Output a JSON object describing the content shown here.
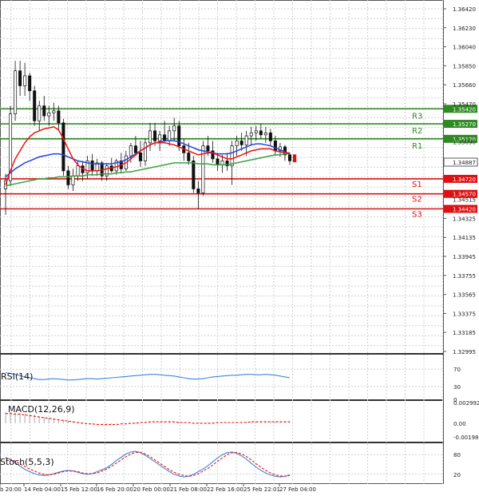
{
  "chart_data": [
    {
      "type": "candlestick",
      "price_axis": [
        "1.36420",
        "1.36230",
        "1.36040",
        "1.35850",
        "1.35660",
        "1.35470",
        "1.35090",
        "1.34325",
        "1.34135",
        "1.33945",
        "1.33755",
        "1.33565",
        "1.33375",
        "1.33185",
        "1.32995"
      ],
      "ylim": [
        1.32995,
        1.3642
      ],
      "x_labels": [
        "b 20:00",
        "14 Feb 04:00",
        "15 Feb 12:00",
        "16 Feb 20:00",
        "20 Feb 00:00",
        "21 Feb 08:00",
        "22 Feb 16:00",
        "25 Feb 22:01",
        "27 Feb 04:00"
      ],
      "current_price": "1.34887",
      "resistance": [
        {
          "name": "R1",
          "value": 1.3512,
          "tag": "1.35120"
        },
        {
          "name": "R2",
          "value": 1.3527,
          "tag": "1.35270"
        },
        {
          "name": "R3",
          "value": 1.3542,
          "tag": "1.35420"
        }
      ],
      "support": [
        {
          "name": "S1",
          "value": 1.3472,
          "tag": "1.34720"
        },
        {
          "name": "S2",
          "value": 1.3457,
          "tag": "1.34570"
        },
        {
          "name": "S3",
          "value": 1.3442,
          "tag": "1.34420"
        }
      ],
      "extra_tag": "1.34515",
      "candles": [
        [
          1.3462,
          1.3477,
          1.3436,
          1.347
        ],
        [
          1.347,
          1.3545,
          1.3465,
          1.3537
        ],
        [
          1.3537,
          1.359,
          1.353,
          1.358
        ],
        [
          1.358,
          1.359,
          1.3555,
          1.3565
        ],
        [
          1.3565,
          1.3588,
          1.3555,
          1.3575
        ],
        [
          1.3575,
          1.3578,
          1.355,
          1.356
        ],
        [
          1.356,
          1.3565,
          1.3525,
          1.353
        ],
        [
          1.353,
          1.355,
          1.352,
          1.3545
        ],
        [
          1.3545,
          1.3555,
          1.353,
          1.3535
        ],
        [
          1.3535,
          1.3545,
          1.3525,
          1.3538
        ],
        [
          1.3538,
          1.3548,
          1.353,
          1.354
        ],
        [
          1.354,
          1.3545,
          1.352,
          1.3528
        ],
        [
          1.3528,
          1.3532,
          1.3475,
          1.348
        ],
        [
          1.348,
          1.3485,
          1.3462,
          1.3466
        ],
        [
          1.3466,
          1.3482,
          1.346,
          1.3475
        ],
        [
          1.3475,
          1.349,
          1.347,
          1.3485
        ],
        [
          1.3485,
          1.349,
          1.347,
          1.3478
        ],
        [
          1.3478,
          1.3495,
          1.3472,
          1.349
        ],
        [
          1.349,
          1.3497,
          1.3475,
          1.348
        ],
        [
          1.348,
          1.3492,
          1.3475,
          1.3488
        ],
        [
          1.3488,
          1.349,
          1.347,
          1.3475
        ],
        [
          1.3475,
          1.3488,
          1.347,
          1.3485
        ],
        [
          1.3485,
          1.3493,
          1.3478,
          1.348
        ],
        [
          1.348,
          1.3492,
          1.3476,
          1.349
        ],
        [
          1.349,
          1.3498,
          1.3478,
          1.3482
        ],
        [
          1.3482,
          1.35,
          1.348,
          1.3495
        ],
        [
          1.3495,
          1.3508,
          1.3488,
          1.3505
        ],
        [
          1.3505,
          1.3515,
          1.3495,
          1.3498
        ],
        [
          1.3498,
          1.351,
          1.3484,
          1.349
        ],
        [
          1.349,
          1.3512,
          1.3485,
          1.3508
        ],
        [
          1.3508,
          1.3528,
          1.35,
          1.352
        ],
        [
          1.352,
          1.3528,
          1.3505,
          1.351
        ],
        [
          1.351,
          1.352,
          1.35,
          1.3516
        ],
        [
          1.3516,
          1.353,
          1.3508,
          1.351
        ],
        [
          1.351,
          1.3525,
          1.3505,
          1.352
        ],
        [
          1.352,
          1.3533,
          1.351,
          1.3525
        ],
        [
          1.3525,
          1.353,
          1.35,
          1.3505
        ],
        [
          1.3505,
          1.3512,
          1.349,
          1.3498
        ],
        [
          1.3498,
          1.3508,
          1.3486,
          1.349
        ],
        [
          1.349,
          1.3495,
          1.3458,
          1.3462
        ],
        [
          1.3462,
          1.347,
          1.3442,
          1.3458
        ],
        [
          1.3458,
          1.351,
          1.3455,
          1.3505
        ],
        [
          1.3505,
          1.3515,
          1.3495,
          1.35
        ],
        [
          1.35,
          1.351,
          1.3488,
          1.3492
        ],
        [
          1.3492,
          1.3498,
          1.348,
          1.3486
        ],
        [
          1.3486,
          1.3496,
          1.3478,
          1.349
        ],
        [
          1.349,
          1.3498,
          1.348,
          1.3485
        ],
        [
          1.3485,
          1.351,
          1.3466,
          1.3505
        ],
        [
          1.3505,
          1.3515,
          1.3495,
          1.351
        ],
        [
          1.351,
          1.3518,
          1.35,
          1.3506
        ],
        [
          1.3506,
          1.352,
          1.3495,
          1.3515
        ],
        [
          1.3515,
          1.3524,
          1.3505,
          1.3518
        ],
        [
          1.3518,
          1.3525,
          1.351,
          1.352
        ],
        [
          1.352,
          1.3527,
          1.3512,
          1.3516
        ],
        [
          1.3516,
          1.3524,
          1.3508,
          1.3518
        ],
        [
          1.3518,
          1.3522,
          1.3505,
          1.351
        ],
        [
          1.351,
          1.3515,
          1.3495,
          1.35
        ],
        [
          1.35,
          1.3508,
          1.3494,
          1.3504
        ],
        [
          1.3504,
          1.3506,
          1.349,
          1.3496
        ],
        [
          1.3496,
          1.3498,
          1.3486,
          1.349
        ]
      ],
      "ma_red": [
        1.3466,
        1.348,
        1.3492,
        1.35,
        1.3508,
        1.3514,
        1.3518,
        1.352,
        1.3522,
        1.3523,
        1.3524,
        1.3521,
        1.3512,
        1.3502,
        1.3492,
        1.3486,
        1.3482,
        1.348,
        1.348,
        1.348,
        1.3481,
        1.3482,
        1.3483,
        1.3484,
        1.3486,
        1.3488,
        1.3492,
        1.3496,
        1.35,
        1.3503,
        1.3506,
        1.3508,
        1.3508,
        1.3508,
        1.3507,
        1.3506,
        1.3504,
        1.3502,
        1.35,
        1.3498,
        1.3496,
        1.3497,
        1.3498,
        1.3498,
        1.3496,
        1.3494,
        1.3492,
        1.3492,
        1.3494,
        1.3496,
        1.3498,
        1.35,
        1.3501,
        1.3502,
        1.3502,
        1.3502,
        1.35,
        1.3499,
        1.3498,
        1.3498
      ],
      "ma_blue": [
        1.3474,
        1.3478,
        1.3482,
        1.3485,
        1.3488,
        1.349,
        1.3492,
        1.3494,
        1.3495,
        1.3496,
        1.3497,
        1.3497,
        1.3496,
        1.3494,
        1.3492,
        1.349,
        1.3489,
        1.3488,
        1.3487,
        1.3487,
        1.3487,
        1.3487,
        1.3487,
        1.3488,
        1.3489,
        1.3491,
        1.3494,
        1.3497,
        1.35,
        1.3503,
        1.3506,
        1.3508,
        1.3509,
        1.351,
        1.351,
        1.351,
        1.3509,
        1.3507,
        1.3505,
        1.3503,
        1.3501,
        1.35,
        1.3499,
        1.3498,
        1.3497,
        1.3497,
        1.3497,
        1.3498,
        1.35,
        1.3502,
        1.3504,
        1.3506,
        1.3507,
        1.3507,
        1.3506,
        1.3505,
        1.3503,
        1.3501,
        1.3499,
        1.3497
      ],
      "ma_green": [
        1.3465,
        1.3466,
        1.3467,
        1.3468,
        1.3469,
        1.347,
        1.3471,
        1.3472,
        1.3472,
        1.3473,
        1.3473,
        1.3474,
        1.3474,
        1.3474,
        1.3475,
        1.3475,
        1.3475,
        1.3476,
        1.3476,
        1.3476,
        1.3477,
        1.3477,
        1.3477,
        1.3478,
        1.3478,
        1.3479,
        1.3479,
        1.348,
        1.3481,
        1.3482,
        1.3483,
        1.3484,
        1.3485,
        1.3486,
        1.3487,
        1.3488,
        1.3488,
        1.3488,
        1.3488,
        1.3488,
        1.3487,
        1.3487,
        1.3487,
        1.3486,
        1.3486,
        1.3486,
        1.3486,
        1.3487,
        1.3488,
        1.3489,
        1.349,
        1.3491,
        1.3492,
        1.3493,
        1.3494,
        1.3495,
        1.3496,
        1.3496,
        1.3497,
        1.3497
      ]
    },
    {
      "type": "line",
      "title": "RSI(14)",
      "ticks": [
        "70",
        "30",
        "0"
      ],
      "ylim": [
        0,
        100
      ],
      "values": [
        62,
        60,
        58,
        55,
        52,
        50,
        48,
        46,
        46,
        47,
        48,
        47,
        46,
        45,
        45,
        46,
        47,
        48,
        48,
        47,
        48,
        49,
        50,
        51,
        52,
        53,
        54,
        55,
        56,
        57,
        58,
        58,
        57,
        56,
        55,
        54,
        52,
        50,
        48,
        47,
        47,
        48,
        50,
        52,
        53,
        54,
        55,
        56,
        56,
        57,
        58,
        58,
        57,
        57,
        58,
        57,
        56,
        54,
        52,
        50
      ]
    },
    {
      "type": "line",
      "title": "MACD(12,26,9)",
      "ticks": [
        "0.002992",
        "0.00",
        "-0.001985"
      ],
      "ylim": [
        -0.001985,
        0.002992
      ],
      "histogram": [
        0.0016,
        0.0016,
        0.0015,
        0.0015,
        0.0014,
        0.0013,
        0.0012,
        0.001,
        0.0009,
        0.0008,
        0.0007,
        0.0006,
        0.0005,
        0.0004,
        0.0003,
        0.0002,
        0.0001,
        0.0,
        -0.0001,
        -0.0001,
        -0.0001,
        -0.0002,
        -0.0002,
        -0.0001,
        -0.0001,
        0.0,
        0.0,
        0.0001,
        0.0001,
        0.0002,
        0.0002,
        0.0002,
        0.0002,
        0.0002,
        0.0002,
        0.0002,
        0.0002,
        0.0001,
        0.0001,
        0.0,
        0.0,
        0.0,
        0.0001,
        0.0001,
        0.0001,
        0.0001,
        0.0001,
        0.0001,
        0.0001,
        0.0002,
        0.0002,
        0.0002,
        0.0002,
        0.0002,
        0.0002,
        0.0002,
        0.0002,
        0.0002,
        0.0002,
        0.0002
      ],
      "signal": [
        0.0014,
        0.0014,
        0.0013,
        0.0013,
        0.0012,
        0.0011,
        0.001,
        0.0009,
        0.0008,
        0.0007,
        0.0006,
        0.0005,
        0.0004,
        0.0003,
        0.0002,
        0.0001,
        0.0,
        -0.0001,
        -0.0001,
        -0.0002,
        -0.0002,
        -0.0002,
        -0.0002,
        -0.0002,
        -0.0001,
        -0.0001,
        0.0,
        0.0,
        0.0001,
        0.0001,
        0.0002,
        0.0002,
        0.0002,
        0.0002,
        0.0002,
        0.0002,
        0.0001,
        0.0001,
        0.0001,
        0.0,
        0.0,
        0.0,
        0.0,
        0.0,
        0.0001,
        0.0001,
        0.0001,
        0.0001,
        0.0001,
        0.0001,
        0.0001,
        0.0002,
        0.0002,
        0.0002,
        0.0002,
        0.0002,
        0.0002,
        0.0002,
        0.0002,
        0.0002
      ]
    },
    {
      "type": "line",
      "title": "Stoch(5,5,3)",
      "ticks": [
        "80",
        "20"
      ],
      "ylim": [
        0,
        100
      ],
      "k": [
        72,
        65,
        55,
        45,
        35,
        28,
        22,
        18,
        16,
        18,
        22,
        26,
        30,
        32,
        30,
        26,
        22,
        20,
        22,
        28,
        34,
        40,
        50,
        62,
        72,
        82,
        88,
        90,
        86,
        78,
        68,
        58,
        48,
        38,
        28,
        20,
        15,
        12,
        14,
        20,
        28,
        36,
        46,
        58,
        70,
        80,
        86,
        88,
        84,
        76,
        66,
        54,
        42,
        32,
        24,
        18,
        14,
        12,
        14,
        18
      ],
      "d": [
        68,
        66,
        60,
        52,
        44,
        36,
        30,
        24,
        20,
        18,
        20,
        24,
        28,
        30,
        30,
        28,
        24,
        22,
        22,
        24,
        30,
        36,
        44,
        54,
        64,
        74,
        82,
        87,
        87,
        82,
        74,
        64,
        54,
        44,
        34,
        26,
        20,
        16,
        14,
        16,
        22,
        30,
        38,
        48,
        60,
        70,
        80,
        86,
        86,
        82,
        74,
        64,
        52,
        42,
        32,
        24,
        18,
        15,
        14,
        16
      ]
    }
  ]
}
